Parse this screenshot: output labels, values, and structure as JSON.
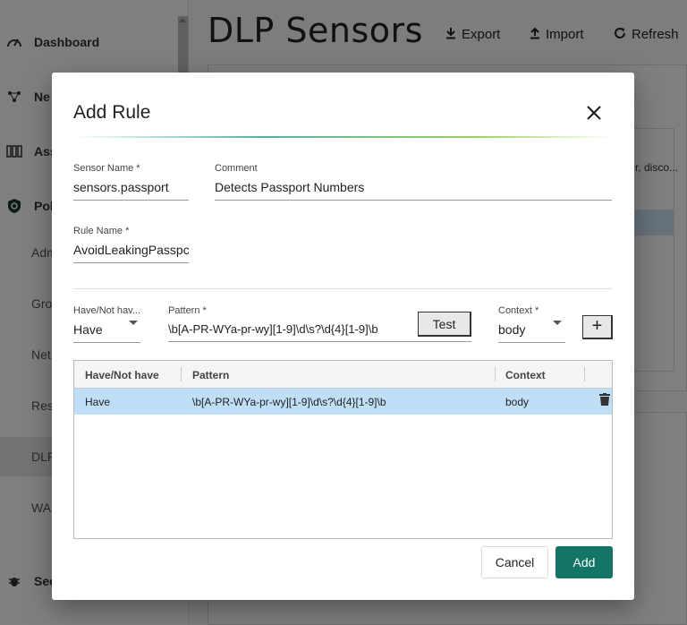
{
  "app": {
    "page_title": "DLP Sensors",
    "toolbar": {
      "export": "Export",
      "import": "Import",
      "refresh": "Refresh"
    },
    "sidebar": {
      "items": [
        {
          "label": "Dashboard"
        },
        {
          "label": "Ne"
        },
        {
          "label": "Ass"
        },
        {
          "label": "Pol"
        },
        {
          "label": "Sec"
        }
      ],
      "subitems": [
        "Adm",
        "Gro",
        "Net",
        "Res",
        "DLP",
        "WA"
      ]
    },
    "bg_cell_text": "r, disco..."
  },
  "dialog": {
    "title": "Add Rule",
    "sensor_name": {
      "label": "Sensor Name *",
      "value": "sensors.passport"
    },
    "comment": {
      "label": "Comment",
      "value": "Detects Passport Numbers"
    },
    "rule_name": {
      "label": "Rule Name *",
      "value": "AvoidLeakingPasspc"
    },
    "have_not_have": {
      "label": "Have/Not hav...",
      "value": "Have"
    },
    "pattern": {
      "label": "Pattern *",
      "value": "\\b[A-PR-WYa-pr-wy][1-9]\\d\\s?\\d{4}[1-9]\\b"
    },
    "test_button": "Test",
    "context": {
      "label": "Context *",
      "value": "body"
    },
    "add_pattern_button": "+",
    "grid": {
      "columns": [
        "Have/Not have",
        "Pattern",
        "Context"
      ],
      "rows": [
        {
          "have": "Have",
          "pattern": "\\b[A-PR-WYa-pr-wy][1-9]\\d\\s?\\d{4}[1-9]\\b",
          "context": "body"
        }
      ]
    },
    "cancel_button": "Cancel",
    "add_button": "Add"
  },
  "colors": {
    "accent": "#137566",
    "row_selected": "#bfdff7"
  }
}
